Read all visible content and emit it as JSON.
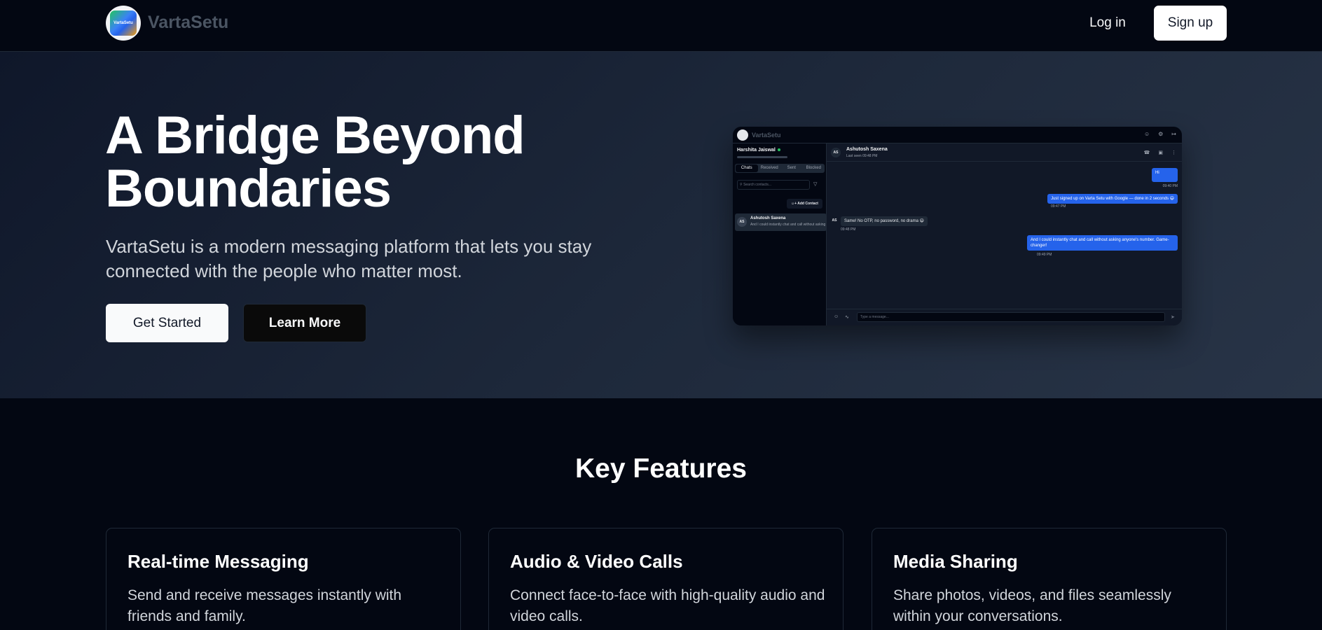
{
  "nav": {
    "brand": "VartaSetu",
    "logo_text": "VartaSetu",
    "login_label": "Log in",
    "signup_label": "Sign up"
  },
  "hero": {
    "title_line1": "A Bridge Beyond",
    "title_line2": "Boundaries",
    "subtitle": "VartaSetu is a modern messaging platform that lets you stay connected with the people who matter most.",
    "primary_cta": "Get Started",
    "secondary_cta": "Learn More"
  },
  "preview": {
    "brand": "VartaSetu",
    "current_user": "Harshita Jaiswal",
    "tabs": [
      "Chats",
      "Received",
      "Sent",
      "Blocked"
    ],
    "search_placeholder": "Search contacts...",
    "add_contact_label": "Add Contact",
    "contact": {
      "initials": "AS",
      "name": "Ashutosh Saxena",
      "preview": "And I could instantly chat and call without asking anyone's number."
    },
    "chat_header": {
      "initials": "AS",
      "name": "Ashutosh Saxena",
      "status": "Last seen 09:48 PM"
    },
    "messages": [
      {
        "direction": "out",
        "text": "Hi",
        "time": "09:40 PM"
      },
      {
        "direction": "out",
        "text": "Just signed up on Varta Setu with Google — done in 2 seconds 😄",
        "time": "09:47 PM"
      },
      {
        "direction": "in",
        "text": "Same! No OTP, no password, no drama 😄",
        "time": "09:48 PM",
        "initials": "AS"
      },
      {
        "direction": "out",
        "text": "And I could instantly chat and call without asking anyone's number. Game-changer!",
        "time": "09:49 PM"
      }
    ],
    "input_placeholder": "Type a message..."
  },
  "features": {
    "title": "Key Features",
    "cards": [
      {
        "title": "Real-time Messaging",
        "desc": "Send and receive messages instantly with friends and family."
      },
      {
        "title": "Audio & Video Calls",
        "desc": "Connect face-to-face with high-quality audio and video calls."
      },
      {
        "title": "Media Sharing",
        "desc": "Share photos, videos, and files seamlessly within your conversations."
      }
    ]
  },
  "icons": {
    "logo": "vartasetu-logo-icon",
    "user": "user-icon",
    "settings": "settings-icon",
    "logout": "logout-icon",
    "search": "search-icon",
    "filter": "filter-icon",
    "add_user": "add-user-icon",
    "phone": "phone-icon",
    "video": "video-icon",
    "more": "more-vertical-icon",
    "emoji": "emoji-icon",
    "attach": "paperclip-icon",
    "send": "send-icon"
  },
  "colors": {
    "background": "#030712",
    "hero_start": "#0f172a",
    "hero_end": "#283447",
    "accent_blue": "#2563eb",
    "online_green": "#22c55e"
  }
}
